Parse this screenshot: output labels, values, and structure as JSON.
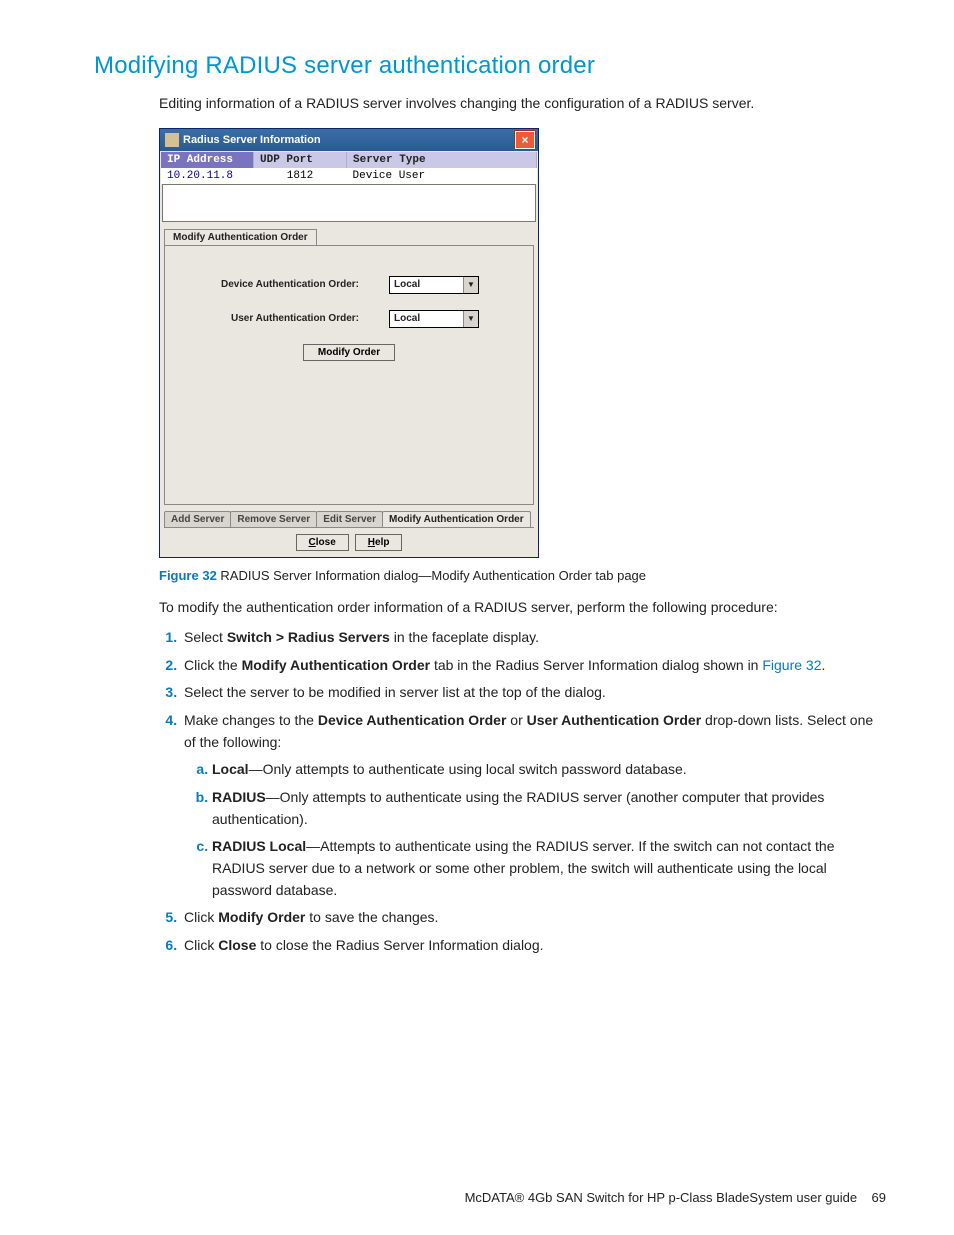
{
  "heading": "Modifying RADIUS server authentication order",
  "intro": "Editing information of a RADIUS server involves changing the configuration of a RADIUS server.",
  "dialog": {
    "title": "Radius Server Information",
    "columns": {
      "ip": "IP Address",
      "port": "UDP Port",
      "type": "Server Type"
    },
    "row": {
      "ip": "10.20.11.8",
      "port": "1812",
      "type": "Device  User"
    },
    "panel_title": "Modify Authentication Order",
    "device_label": "Device Authentication Order:",
    "user_label": "User Authentication Order:",
    "device_value": "Local",
    "user_value": "Local",
    "modify_btn": "Modify Order",
    "tabs": {
      "add": "Add Server",
      "remove": "Remove Server",
      "edit": "Edit Server",
      "modify": "Modify Authentication Order"
    },
    "close": "Close",
    "help": "Help"
  },
  "caption": {
    "label": "Figure 32",
    "text": " RADIUS Server Information dialog—Modify Authentication Order tab page"
  },
  "lead": "To modify the authentication order information of a RADIUS server, perform the following procedure:",
  "steps": {
    "s1a": "Select ",
    "s1b": "Switch > Radius Servers",
    "s1c": " in the faceplate display.",
    "s2a": "Click the ",
    "s2b": "Modify Authentication Order",
    "s2c": " tab in the Radius Server Information dialog shown in ",
    "s2d": "Figure 32",
    "s2e": ".",
    "s3": "Select the server to be modified in server list at the top of the dialog.",
    "s4a": "Make changes to the ",
    "s4b": "Device Authentication Order",
    "s4c": " or ",
    "s4d": "User Authentication Order",
    "s4e": " drop-down lists. Select one of the following:",
    "sa_b": "Local",
    "sa_t": "—Only attempts to authenticate using local switch password database.",
    "sb_b": "RADIUS",
    "sb_t": "—Only attempts to authenticate using the RADIUS server (another computer that provides authentication).",
    "sc_b": "RADIUS Local",
    "sc_t": "—Attempts to authenticate using the RADIUS server. If the switch can not contact the RADIUS server due to a network or some other problem, the switch will authenticate using the local password database.",
    "s5a": "Click ",
    "s5b": "Modify Order",
    "s5c": " to save the changes.",
    "s6a": "Click ",
    "s6b": "Close",
    "s6c": " to close the Radius Server Information dialog."
  },
  "footer": {
    "text": "McDATA® 4Gb SAN Switch for HP p-Class BladeSystem user guide",
    "page": "69"
  }
}
